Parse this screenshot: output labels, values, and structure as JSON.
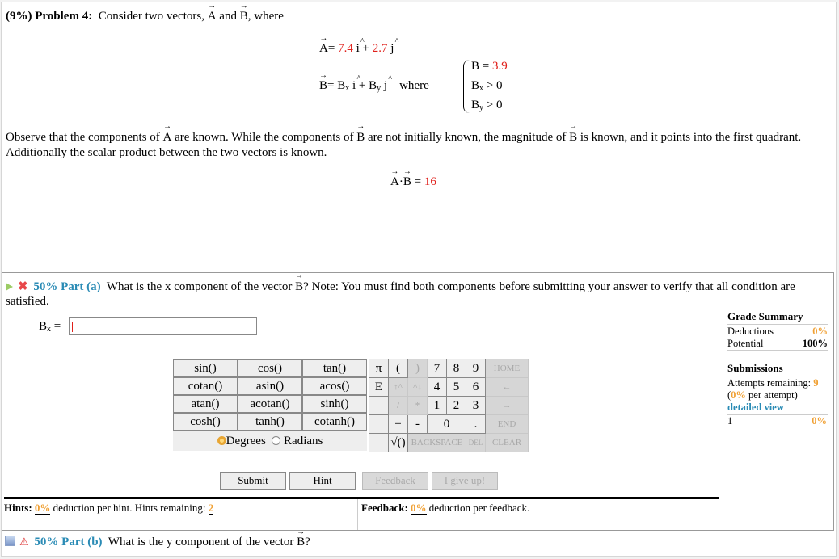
{
  "problem": {
    "percent": "(9%)",
    "label": "Problem 4:",
    "intro": "Consider two vectors,",
    "vecA": "A",
    "and": "and",
    "vecB": "B",
    "where_suffix": ", where",
    "A_x": "7.4",
    "A_y": "2.7",
    "i_hat": "i",
    "j_hat": "j",
    "B_eq_text": "B = ",
    "Bx": "B",
    "Bx_sub": "x",
    "By": "B",
    "By_sub": "y",
    "where": "where",
    "cond_B_label": "B = ",
    "cond_B_value": "3.9",
    "cond_Bx": "> 0",
    "cond_By": "> 0",
    "observe_1": "Observe that the components of",
    "observe_2": "are known. While the components of",
    "observe_3": "are not initially known, the magnitude of",
    "observe_4": "is known, and it points into the first quadrant. Additionally the scalar product between the two vectors is known.",
    "dot_value": "16"
  },
  "part_a": {
    "title": "50% Part (a)",
    "question_1": "What is the x component of the vector",
    "question_2": "? Note: You must find both components before submitting your answer to verify that all condition are satisfied.",
    "input_label_main": "B",
    "input_label_sub": "x",
    "input_value": "",
    "grade_summary": {
      "heading": "Grade Summary",
      "deductions_label": "Deductions",
      "deductions_value": "0%",
      "potential_label": "Potential",
      "potential_value": "100%"
    },
    "submissions": {
      "heading": "Submissions",
      "attempts_label": "Attempts remaining:",
      "attempts_value": "9",
      "per_attempt_value": "0%",
      "per_attempt_label": "per attempt)",
      "detailed_view": "detailed view",
      "history": [
        {
          "attempt": "1",
          "score": "0%"
        }
      ]
    },
    "functions": [
      [
        "sin()",
        "cos()",
        "tan()"
      ],
      [
        "cotan()",
        "asin()",
        "acos()"
      ],
      [
        "atan()",
        "acotan()",
        "sinh()"
      ],
      [
        "cosh()",
        "tanh()",
        "cotanh()"
      ]
    ],
    "angle_modes": {
      "degrees": "Degrees",
      "radians": "Radians",
      "selected": "Degrees"
    },
    "keys": {
      "pi": "π",
      "E": "E",
      "lparen": "(",
      "rparen": ")",
      "up": "↑^",
      "down": "^↓",
      "slash": "/",
      "star": "*",
      "plus": "+",
      "minus": "-",
      "sqrt": "√()",
      "n7": "7",
      "n8": "8",
      "n9": "9",
      "n4": "4",
      "n5": "5",
      "n6": "6",
      "n1": "1",
      "n2": "2",
      "n3": "3",
      "n0": "0",
      "dot": ".",
      "home": "HOME",
      "left": "←",
      "right": "→",
      "end": "END",
      "backspace": "BACKSPACE",
      "del": "DEL",
      "clear": "CLEAR"
    },
    "buttons": {
      "submit": "Submit",
      "hint": "Hint",
      "feedback": "Feedback",
      "give_up": "I give up!"
    },
    "hints": {
      "label": "Hints:",
      "deduction": "0%",
      "text": "deduction per hint. Hints remaining:",
      "remaining": "2"
    },
    "feedback": {
      "label": "Feedback:",
      "deduction": "0%",
      "text": "deduction per feedback."
    }
  },
  "part_b": {
    "title": "50% Part (b)",
    "question": "What is the y component of the vector",
    "vec": "B",
    "q_suffix": "?"
  }
}
